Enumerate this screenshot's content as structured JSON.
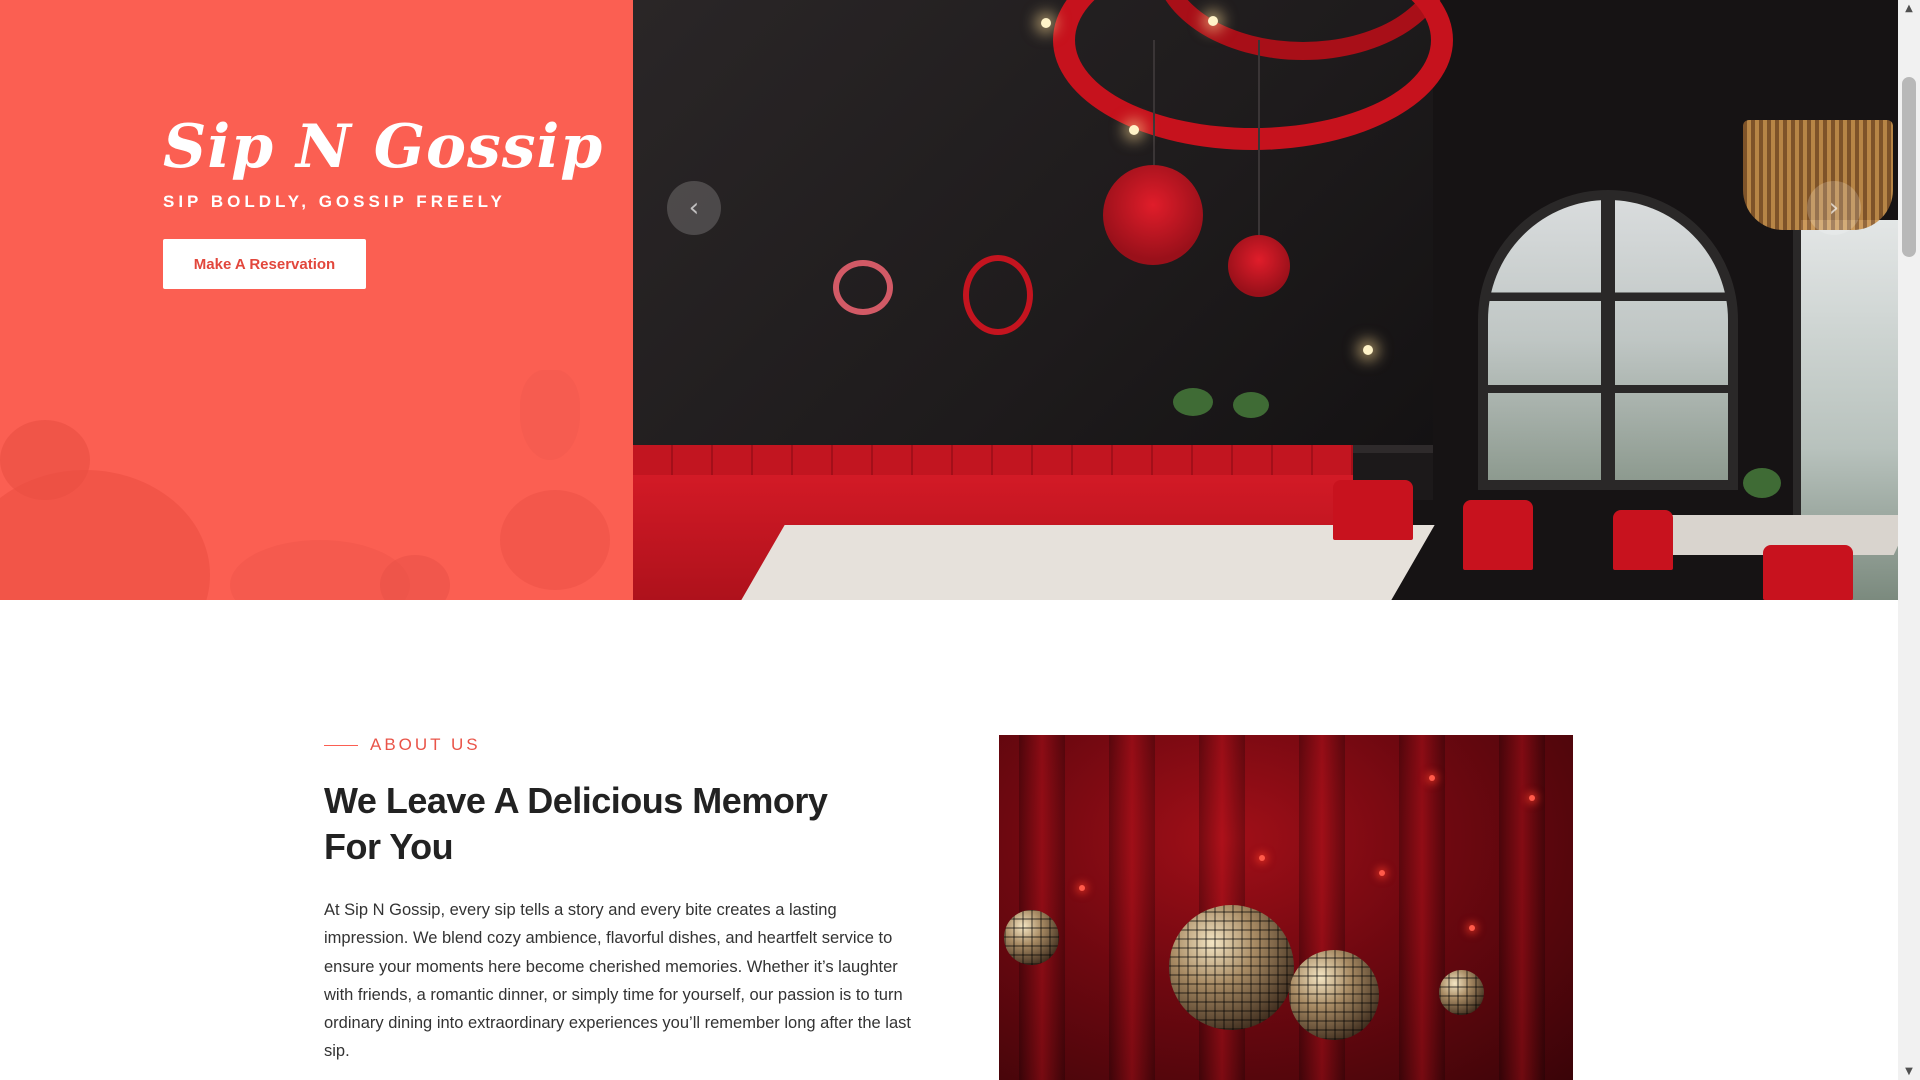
{
  "hero": {
    "brand": "Sip N Gossip",
    "tagline": "SIP BOLDLY, GOSSIP FREELY",
    "cta_label": "Make A Reservation",
    "prev_arrow": "‹",
    "next_arrow": "›",
    "left_panel_color": "#fb5f52"
  },
  "about": {
    "eyebrow": "ABOUT US",
    "title": "We Leave A Delicious Memory For You",
    "body": "At Sip N Gossip, every sip tells a story and every bite creates a lasting impression. We blend cozy ambience, flavorful dishes, and heartfelt service to ensure your moments here become cherished memories. Whether it’s laughter with friends, a romantic dinner, or simply time for yourself, our passion is to turn ordinary dining into extraordinary experiences you’ll remember long after the last sip.",
    "accent_color": "#e95448"
  },
  "scrollbar": {
    "up_icon": "▲",
    "down_icon": "▼"
  },
  "icons": {
    "prev": "chevron-left-icon",
    "next": "chevron-right-icon",
    "scroll_up": "triangle-up-icon",
    "scroll_down": "triangle-down-icon"
  }
}
